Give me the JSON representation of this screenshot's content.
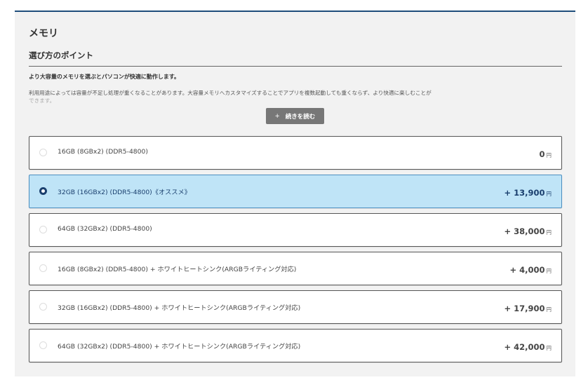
{
  "section": {
    "title": "メモリ",
    "subtitle": "選び方のポイント",
    "lead": "より大容量のメモリを選ぶとパソコンが快適に動作します。",
    "description_line1": "利用用途によっては容量が不足し処理が重くなることがあります。大容量メモリへカスタマイズすることでアプリを複数起動しても重くならず、より快適に楽しむことが",
    "description_line2": "できます。",
    "read_more_plus": "+",
    "read_more_label": "続きを読む"
  },
  "options": [
    {
      "label": "16GB (8GBx2) (DDR5-4800)",
      "price": "0",
      "currency": "円",
      "selected": false
    },
    {
      "label": "32GB (16GBx2) (DDR5-4800)《オススメ》",
      "price": "+ 13,900",
      "currency": "円",
      "selected": true
    },
    {
      "label": "64GB (32GBx2) (DDR5-4800)",
      "price": "+ 38,000",
      "currency": "円",
      "selected": false
    },
    {
      "label": "16GB (8GBx2) (DDR5-4800) + ホワイトヒートシンク(ARGBライティング対応)",
      "price": "+ 4,000",
      "currency": "円",
      "selected": false
    },
    {
      "label": "32GB (16GBx2) (DDR5-4800) + ホワイトヒートシンク(ARGBライティング対応)",
      "price": "+ 17,900",
      "currency": "円",
      "selected": false
    },
    {
      "label": "64GB (32GBx2) (DDR5-4800) + ホワイトヒートシンク(ARGBライティング対応)",
      "price": "+ 42,000",
      "currency": "円",
      "selected": false
    }
  ],
  "colors": {
    "accent_border": "#1e4d7b",
    "selected_bg": "#bfe4f7",
    "selected_text": "#1a3f6e",
    "button_bg": "#777777"
  }
}
